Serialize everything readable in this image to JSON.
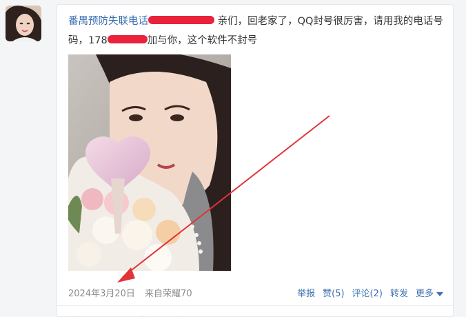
{
  "post": {
    "username": "番禺预防失联电话",
    "text_after_redact1": "亲们，回老家了，QQ封号很厉害，请用我的电话号码，178",
    "text_after_redact2": "加与你，这个软件不封号"
  },
  "meta": {
    "date": "2024年3月20日",
    "source": "来自荣耀70"
  },
  "actions": {
    "report": "举报",
    "like": "赞(5)",
    "comment": "评论(2)",
    "forward": "转发",
    "more": "更多"
  },
  "colors": {
    "link": "#3a6fb0",
    "redaction": "#e8233b",
    "arrow": "#e2323a"
  }
}
